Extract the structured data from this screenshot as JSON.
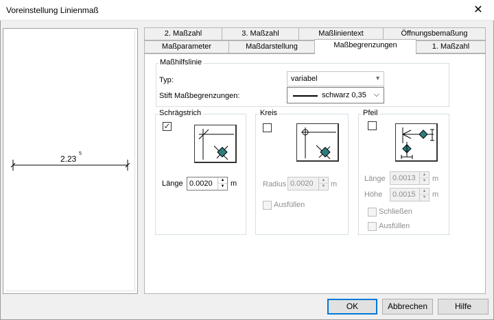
{
  "window": {
    "title": "Voreinstellung Linienmaß",
    "close_glyph": "✕"
  },
  "preview": {
    "dimension_text": "2.23",
    "superscript": "5"
  },
  "tabs": {
    "row1": [
      "2. Maßzahl",
      "3. Maßzahl",
      "Maßlinientext",
      "Öffnungsbemaßung"
    ],
    "row2": [
      "Maßparameter",
      "Maßdarstellung",
      "Maßbegrenzungen",
      "1. Maßzahl"
    ],
    "active": "Maßbegrenzungen"
  },
  "masshilfslinie": {
    "title": "Maßhilfslinie",
    "typ_label": "Typ:",
    "typ_value": "variabel",
    "stift_label": "Stift Maßbegrenzungen:",
    "stift_value": "schwarz 0,35"
  },
  "schraegstrich": {
    "title": "Schrägstrich",
    "checked": true,
    "check_glyph": "✓",
    "laenge_label": "Länge",
    "laenge_value": "0.0020",
    "unit": "m"
  },
  "kreis": {
    "title": "Kreis",
    "checked": false,
    "radius_label": "Radius",
    "radius_value": "0.0020",
    "unit": "m",
    "ausfuellen_label": "Ausfüllen"
  },
  "pfeil": {
    "title": "Pfeil",
    "checked": false,
    "laenge_label": "Länge",
    "laenge_value": "0.0013",
    "hoehe_label": "Höhe",
    "hoehe_value": "0.0015",
    "unit": "m",
    "schliessen_label": "Schließen",
    "ausfuellen_label": "Ausfüllen"
  },
  "buttons": {
    "ok": "OK",
    "cancel": "Abbrechen",
    "help": "Hilfe"
  },
  "colors": {
    "marker_fill": "#2e7d7d",
    "default_button_border": "#0078d7"
  }
}
